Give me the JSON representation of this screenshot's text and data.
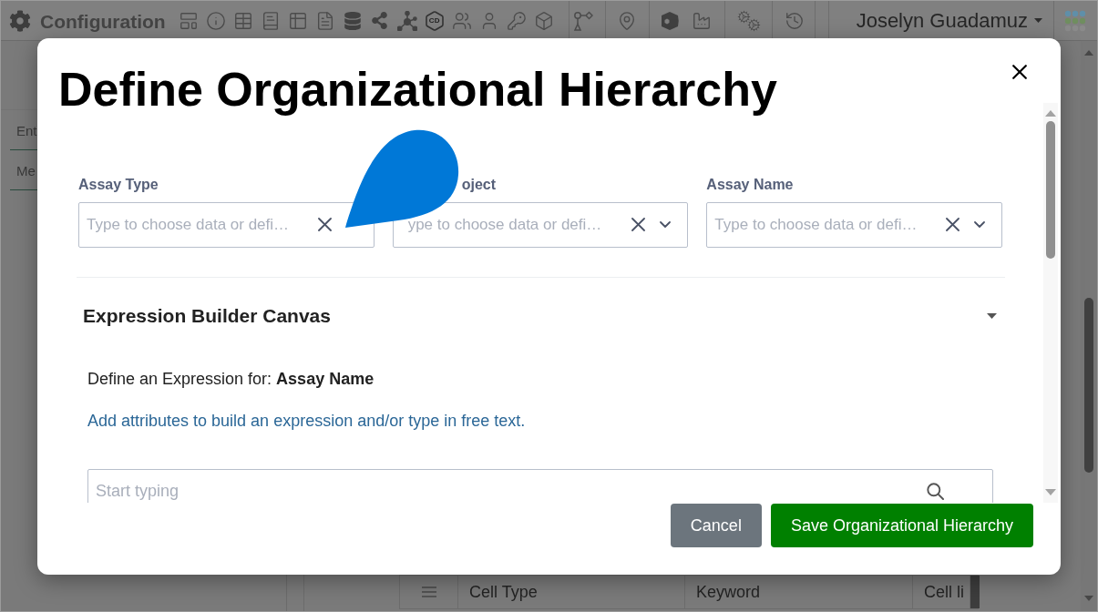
{
  "top_bar": {
    "title": "Configuration",
    "icon_badge": "CD",
    "user_name": "Joselyn Guadamuz"
  },
  "left_panel": {
    "fields": [
      {
        "placeholder": "Ent"
      },
      {
        "placeholder": "Me"
      }
    ]
  },
  "table": {
    "rows": [
      {
        "cells": [
          "Cell Type",
          "Keyword",
          "Cell li"
        ]
      }
    ]
  },
  "dialog": {
    "title": "Define Organizational Hierarchy",
    "fields": [
      {
        "label": "Assay Type",
        "placeholder": "Type to choose data or defi…",
        "obscured": false,
        "chevron": false
      },
      {
        "label": "oject",
        "placeholder": "ype to choose data or defi…",
        "obscured": true,
        "chevron": true
      },
      {
        "label": "Assay Name",
        "placeholder": "Type to choose data or defi…",
        "obscured": false,
        "chevron": true
      }
    ],
    "section": {
      "title": "Expression Builder Canvas",
      "expanded": true,
      "prompt": "Define an Expression for: **Assay Name**",
      "hint": "Add attributes to build an expression and/or type in free text.",
      "search": {
        "placeholder": "Start typing"
      }
    },
    "buttons": [
      {
        "label": "Cancel",
        "kind": "secondary"
      },
      {
        "label": "Save Organizational Hierarchy",
        "kind": "primary"
      }
    ]
  }
}
